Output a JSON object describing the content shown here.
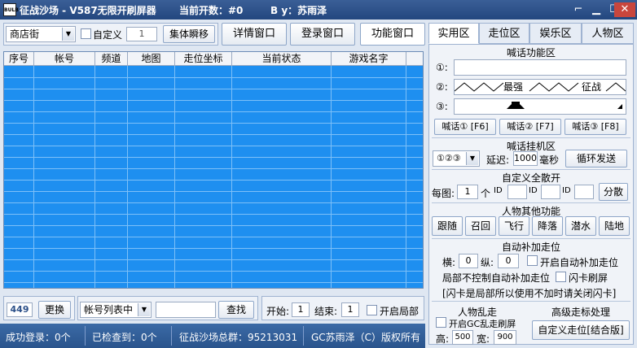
{
  "window": {
    "title": "征战沙场 - V587无限开刷屏器",
    "open_count": "当前开数：#0",
    "author": "B y：苏雨泽",
    "logo_text": "BULB",
    "min": "▁",
    "max": "☐",
    "close": "✕",
    "extra": "⌐"
  },
  "top": {
    "map_select": "商店街",
    "custom_label": "自定义",
    "custom_value": "1",
    "gather_btn": "集体瞬移",
    "detail_btn": "详情窗口",
    "login_btn": "登录窗口",
    "func_btn": "功能窗口"
  },
  "table": {
    "columns": [
      "序号",
      "帐号",
      "频道",
      "地图",
      "走位坐标",
      "当前状态",
      "游戏名字"
    ]
  },
  "bottom": {
    "count": "449",
    "change_btn": "更换",
    "list_select": "帐号列表中",
    "search_value": "",
    "search_btn": "查找",
    "start_label": "开始:",
    "start_value": "1",
    "end_label": "结束:",
    "end_value": "1",
    "local_label": "开启局部"
  },
  "status": {
    "login_success": "成功登录：0个",
    "checked": "已检查到：0个",
    "group": "征战沙场总群：95213031",
    "copyright": "GC苏雨泽（C）版权所有"
  },
  "tabs": [
    "实用区",
    "走位区",
    "娱乐区",
    "人物区"
  ],
  "shout": {
    "title": "喊话功能区",
    "row1_label": "①:",
    "row2_label": "②:",
    "row2_text1": "最强",
    "row2_text2": "征战",
    "row3_label": "③:",
    "btn1": "喊话① [F6]",
    "btn2": "喊话② [F7]",
    "btn3": "喊话③ [F8]"
  },
  "hang": {
    "title": "喊话挂机区",
    "select": "①②③",
    "delay_label": "延迟:",
    "delay_value": "1000",
    "ms_label": "毫秒",
    "loop_btn": "循环发送"
  },
  "split": {
    "title": "自定义全散开",
    "map_label": "每图:",
    "map_value": "1",
    "unit": "个",
    "id1": "ID",
    "id2": "ID",
    "id3": "ID",
    "btn": "分散"
  },
  "char": {
    "title": "人物其他功能",
    "buttons": [
      "跟随",
      "召回",
      "飞行",
      "降落",
      "潜水",
      "陆地"
    ]
  },
  "auto": {
    "title": "自动补加走位",
    "x_label": "横:",
    "x_value": "0",
    "y_label": "纵:",
    "y_value": "0",
    "enable_label": "开启自动补加走位",
    "local_label": "局部不控制自动补加走位",
    "flash_label": "闪卡刷屏",
    "note": "[闪卡是局部所以使用不加时请关闭闪卡]"
  },
  "random": {
    "title": "人物乱走",
    "gc_label": "开启GC乱走刷屏",
    "h_label": "高:",
    "h_value": "500",
    "w_label": "宽:",
    "w_value": "900"
  },
  "advanced": {
    "title": "高级走标处理",
    "btn": "自定义走位[结合版]"
  }
}
